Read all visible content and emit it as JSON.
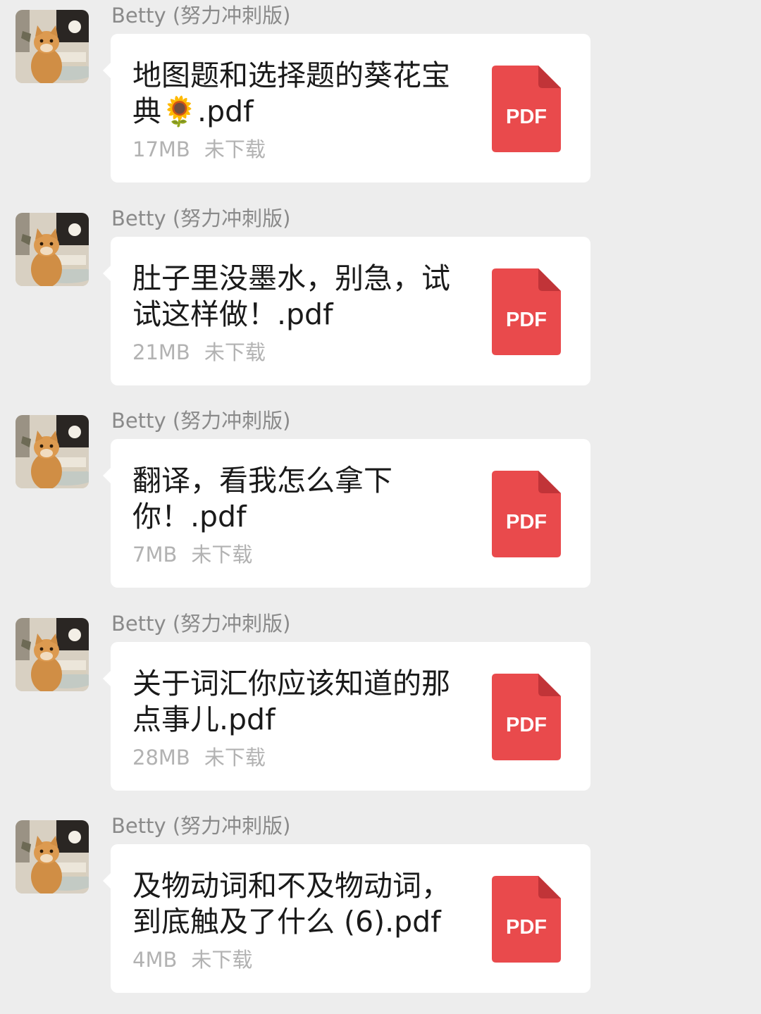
{
  "sender_name": "Betty (努力冲刺版)",
  "messages": [
    {
      "file_name": "地图题和选择题的葵花宝典🌻.pdf",
      "size": "17MB",
      "status": "未下载",
      "icon_label": "PDF"
    },
    {
      "file_name": "肚子里没墨水，别急，试试这样做！.pdf",
      "size": "21MB",
      "status": "未下载",
      "icon_label": "PDF"
    },
    {
      "file_name": "翻译，看我怎么拿下你！.pdf",
      "size": "7MB",
      "status": "未下载",
      "icon_label": "PDF"
    },
    {
      "file_name": "关于词汇你应该知道的那点事儿.pdf",
      "size": "28MB",
      "status": "未下载",
      "icon_label": "PDF"
    },
    {
      "file_name": "及物动词和不及物动词，到底触及了什么 (6).pdf",
      "size": "4MB",
      "status": "未下载",
      "icon_label": "PDF"
    }
  ],
  "colors": {
    "background": "#ededed",
    "bubble": "#ffffff",
    "pdf_icon": "#e94a4c",
    "pdf_fold": "#c13438",
    "meta_text": "#b2b2b2",
    "sender_text": "#8a8a8a"
  },
  "icons": {
    "avatar": "cat-avatar",
    "file": "pdf-file-icon"
  }
}
